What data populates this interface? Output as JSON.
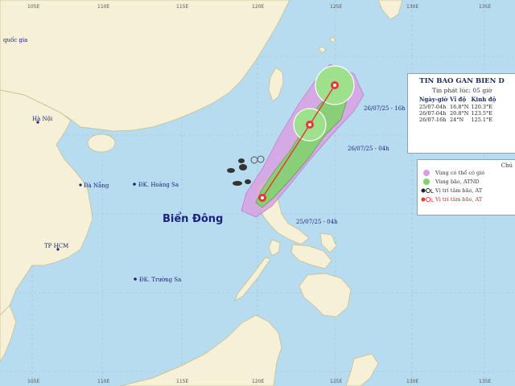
{
  "map": {
    "longitude_ticks": [
      "105E",
      "110E",
      "115E",
      "120E",
      "125E",
      "130E",
      "135E"
    ],
    "place_labels": {
      "country": "quốc gia",
      "hanoi": "Hà Nội",
      "danang": "Đà Nẵng",
      "hcm": "TP HCM",
      "hoangsa": "ĐK. Hoàng Sa",
      "truongsa": "ĐK. Trường Sa",
      "sea": "Biển Đông"
    },
    "track_labels": {
      "p1": "25/07/25 - 04h",
      "p2": "26/07/25 - 04h",
      "p3": "26/07/25 - 16h"
    },
    "colors": {
      "sea": "#b8dcef",
      "land": "#f5f0d6",
      "risk_area": "#d9a0e0",
      "wind_area": "#7fd36a",
      "track": "#e53935"
    }
  },
  "info": {
    "title": "TIN BAO GAN BIEN D",
    "issued": "Tin phát lúc: 05 giờ",
    "headers": [
      "Ngày-giờ",
      "Vĩ độ",
      "Kinh độ"
    ],
    "rows": [
      [
        "25/07-04h",
        "16.8°N",
        "120.3°E"
      ],
      [
        "26/07-04h",
        "20.8°N",
        "123.5°E"
      ],
      [
        "26/07-16h",
        "24°N",
        "125.1°E"
      ]
    ]
  },
  "legend": {
    "title": "Chú",
    "items": [
      {
        "label": "Vùng có thể có gió",
        "color": "#333333",
        "icon": "purple-area-icon"
      },
      {
        "label": "Vùng bão, ATND",
        "color": "#333333",
        "icon": "green-area-icon"
      },
      {
        "label": "Vị trí tâm bão, AT",
        "color": "#333333",
        "icon": "black-storm-symbols-icon"
      },
      {
        "label": "Vị trí tâm bão, AT",
        "color": "#c62828",
        "icon": "red-storm-symbols-icon"
      }
    ]
  }
}
